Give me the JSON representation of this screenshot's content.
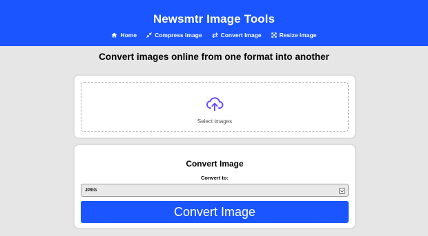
{
  "header": {
    "title": "Newsmtr Image Tools",
    "nav": [
      {
        "label": "Home",
        "icon": "home-icon"
      },
      {
        "label": "Compress Image",
        "icon": "compress-icon"
      },
      {
        "label": "Convert Image",
        "icon": "convert-arrows-icon"
      },
      {
        "label": "Resize Image",
        "icon": "resize-icon"
      }
    ]
  },
  "headline": "Convert images online from one format into another",
  "upload": {
    "label": "Select images",
    "icon": "cloud-upload-icon"
  },
  "convert": {
    "title": "Convert Image",
    "field_label": "Convert to:",
    "selected_format": "JPEG",
    "button_label": "Convert Image"
  },
  "colors": {
    "accent": "#1a55ff",
    "upload_icon": "#6a4cff",
    "background": "#e6e6e6"
  }
}
